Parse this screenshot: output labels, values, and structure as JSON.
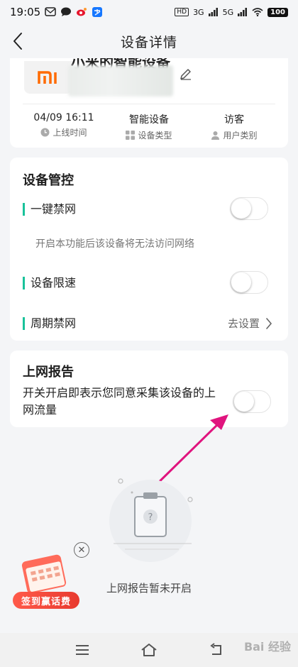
{
  "status_bar": {
    "time": "19:05",
    "network_left": "HD",
    "network_3g": "3G",
    "network_5g": "5G",
    "battery": "100",
    "icons": [
      "message-icon",
      "chat-icon",
      "weibo-icon",
      "alipay-icon"
    ]
  },
  "header": {
    "title": "设备详情"
  },
  "device": {
    "name": "小米的智能设备",
    "logo_text": "mi",
    "online_time": "04/09 16:11",
    "online_time_label": "上线时间",
    "device_type": "智能设备",
    "device_type_label": "设备类型",
    "user_type": "访客",
    "user_type_label": "用户类别"
  },
  "control": {
    "title": "设备管控",
    "block_label": "一键禁网",
    "block_on": false,
    "block_desc": "开启本功能后该设备将无法访问网络",
    "limit_label": "设备限速",
    "limit_on": false,
    "schedule_label": "周期禁网",
    "schedule_action": "去设置"
  },
  "report": {
    "title": "上网报告",
    "desc": "开关开启即表示您同意采集该设备的上网流量",
    "report_on": false,
    "empty_text": "上网报告暂未开启"
  },
  "promo": {
    "label": "签到赢话费"
  },
  "watermark": "Bai 经验",
  "colors": {
    "accent": "#19c29a",
    "arrow": "#e0147e",
    "mi_orange": "#ff6a00",
    "promo_red": "#e83a2f"
  }
}
